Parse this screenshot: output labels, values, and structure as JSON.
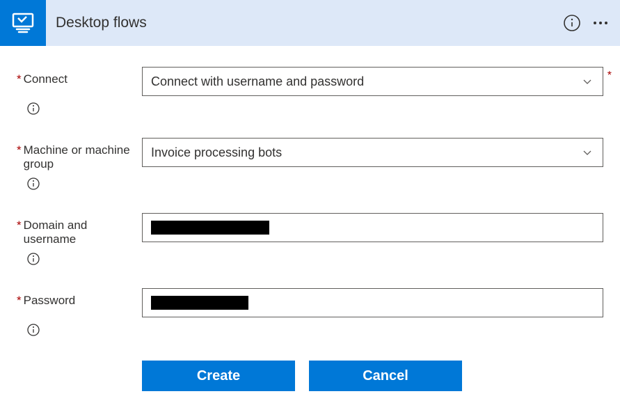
{
  "header": {
    "title": "Desktop flows"
  },
  "form": {
    "connect": {
      "label": "Connect",
      "value": "Connect with username and password",
      "required": true
    },
    "machine": {
      "label": "Machine or machine group",
      "value": "Invoice processing bots",
      "required": true
    },
    "domain": {
      "label": "Domain and username",
      "value": "",
      "required": true
    },
    "password": {
      "label": "Password",
      "value": "",
      "required": true
    }
  },
  "buttons": {
    "create": "Create",
    "cancel": "Cancel"
  }
}
